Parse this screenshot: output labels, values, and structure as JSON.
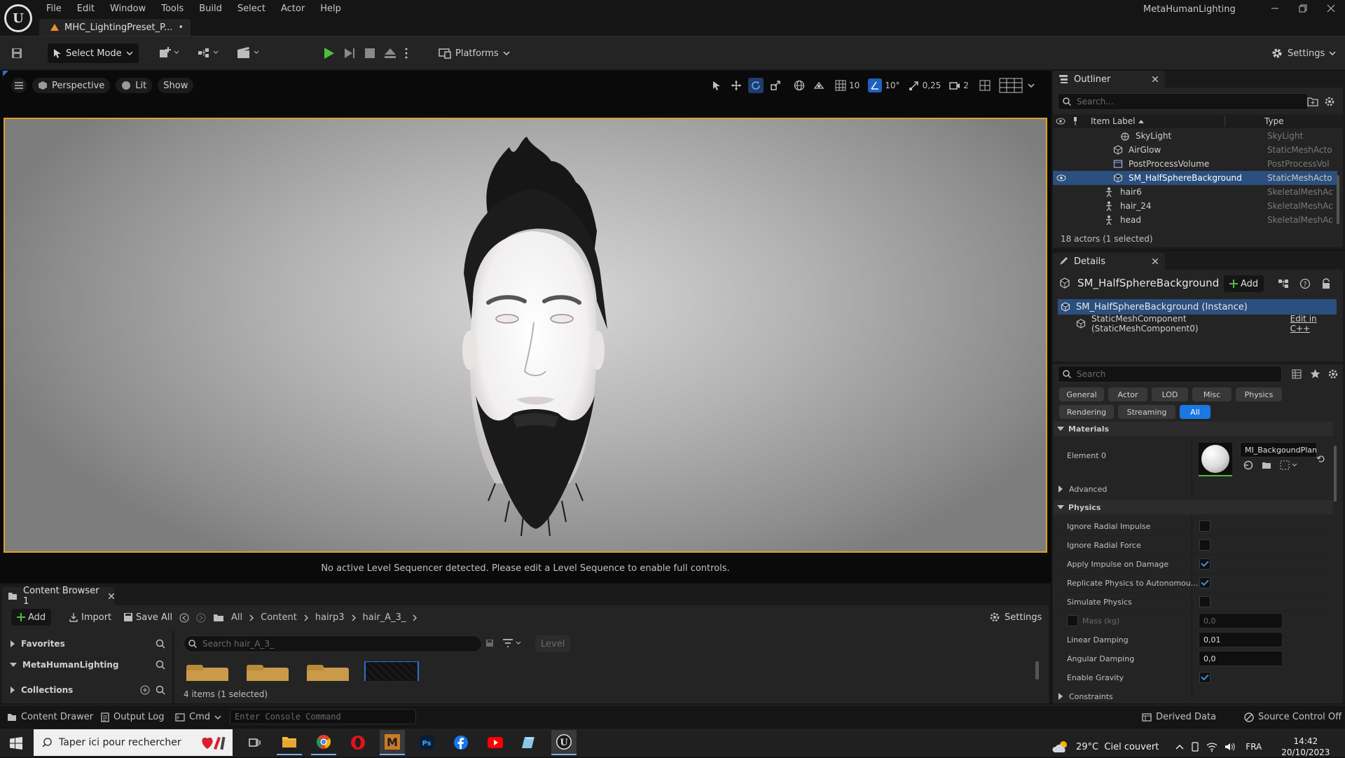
{
  "menu": {
    "items": [
      "File",
      "Edit",
      "Window",
      "Tools",
      "Build",
      "Select",
      "Actor",
      "Help"
    ]
  },
  "window": {
    "project_title": "MetaHumanLighting",
    "tab_title": "MHC_LightingPreset_P...",
    "tab_modified": "•"
  },
  "toolbar": {
    "select_mode": "Select Mode",
    "platforms": "Platforms",
    "settings": "Settings"
  },
  "viewport": {
    "perspective": "Perspective",
    "lit": "Lit",
    "show": "Show",
    "grid_snap": "10",
    "rot_snap": "10°",
    "scale_snap": "0,25",
    "camera_speed": "2",
    "sequencer_msg": "No active Level Sequencer detected. Please edit a Level Sequence to enable full controls."
  },
  "outliner": {
    "title": "Outliner",
    "search_placeholder": "Search...",
    "col_label": "Item Label",
    "col_type": "Type",
    "rows": [
      {
        "label": "SkyLight",
        "type": "SkyLight",
        "icon": "skylight-icon"
      },
      {
        "label": "AirGlow",
        "type": "StaticMeshActo",
        "icon": "static-mesh-icon"
      },
      {
        "label": "PostProcessVolume",
        "type": "PostProcessVol",
        "icon": "volume-icon"
      },
      {
        "label": "SM_HalfSphereBackground",
        "type": "StaticMeshActo",
        "icon": "static-mesh-icon",
        "selected": true
      },
      {
        "label": "hair6",
        "type": "SkeletalMeshAc",
        "icon": "skeletal-mesh-icon"
      },
      {
        "label": "hair_24",
        "type": "SkeletalMeshAc",
        "icon": "skeletal-mesh-icon"
      },
      {
        "label": "head",
        "type": "SkeletalMeshAc",
        "icon": "skeletal-mesh-icon"
      }
    ],
    "status": "18 actors (1 selected)"
  },
  "details": {
    "title": "Details",
    "actor_name": "SM_HalfSphereBackground",
    "add": "Add",
    "instance": "SM_HalfSphereBackground (Instance)",
    "component": "StaticMeshComponent (StaticMeshComponent0)",
    "edit_cpp": "Edit in C++",
    "search_placeholder": "Search",
    "filters_row1": [
      "General",
      "Actor",
      "LOD",
      "Misc",
      "Physics"
    ],
    "filters_row2": [
      "Rendering",
      "Streaming",
      "All"
    ],
    "materials_header": "Materials",
    "element0": "Element 0",
    "material_name": "MI_BackgoundPlane",
    "advanced": "Advanced",
    "physics_header": "Physics",
    "physics_rows": [
      {
        "label": "Ignore Radial Impulse",
        "checked": false
      },
      {
        "label": "Ignore Radial Force",
        "checked": false
      },
      {
        "label": "Apply Impulse on Damage",
        "checked": true
      },
      {
        "label": "Replicate Physics to Autonomou...",
        "checked": true
      },
      {
        "label": "Simulate Physics",
        "checked": false
      }
    ],
    "mass_label": "Mass (kg)",
    "mass_value": "0,0",
    "linear_damping_label": "Linear Damping",
    "linear_damping_value": "0,01",
    "angular_damping_label": "Angular Damping",
    "angular_damping_value": "0,0",
    "enable_gravity_label": "Enable Gravity",
    "constraints": "Constraints"
  },
  "content_browser": {
    "tab": "Content Browser 1",
    "add": "Add",
    "import": "Import",
    "save_all": "Save All",
    "breadcrumb": [
      "All",
      "Content",
      "hairp3",
      "hair_A_3_"
    ],
    "settings": "Settings",
    "favorites": "Favorites",
    "project": "MetaHumanLighting",
    "collections": "Collections",
    "search_placeholder": "Search hair_A_3_",
    "level": "Level",
    "status": "4 items (1 selected)"
  },
  "statusbar": {
    "content_drawer": "Content Drawer",
    "output_log": "Output Log",
    "cmd": "Cmd",
    "console_placeholder": "Enter Console Command",
    "derived_data": "Derived Data",
    "source_control": "Source Control Off"
  },
  "taskbar": {
    "search_placeholder": "Taper ici pour rechercher",
    "weather": "29°C  Ciel couvert",
    "lang": "FRA",
    "time": "14:42",
    "date": "20/10/2023"
  }
}
